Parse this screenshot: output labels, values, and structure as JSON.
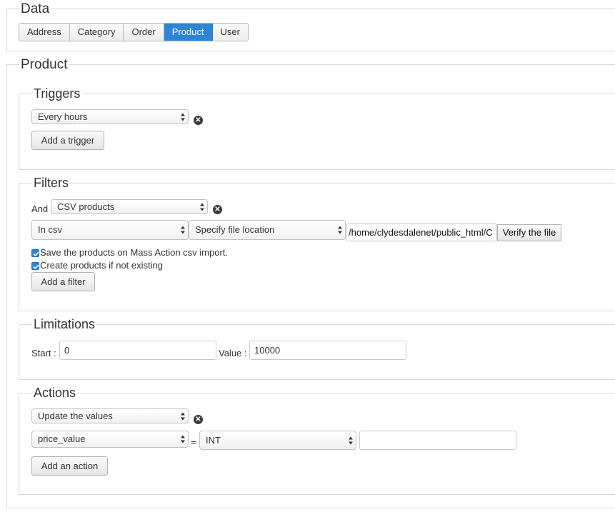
{
  "data_section": {
    "legend": "Data",
    "tabs": [
      {
        "label": "Address"
      },
      {
        "label": "Category"
      },
      {
        "label": "Order"
      },
      {
        "label": "Product"
      },
      {
        "label": "User"
      }
    ],
    "active_tab": "Product"
  },
  "product_section": {
    "legend": "Product",
    "triggers": {
      "legend": "Triggers",
      "select_value": "Every hours",
      "add_button": "Add a trigger"
    },
    "filters": {
      "legend": "Filters",
      "and_label": "And",
      "type_select_value": "CSV products",
      "in_csv_select_value": "In csv",
      "location_select_value": "Specify file location",
      "file_path_value": "/home/clydesdalenet/public_html/C",
      "verify_button": "Verify the file",
      "checkbox_save_label": "Save the products on Mass Action csv import.",
      "checkbox_create_label": "Create products if not existing",
      "add_button": "Add a filter"
    },
    "limitations": {
      "legend": "Limitations",
      "start_label": "Start :",
      "start_value": "0",
      "value_label": "Value :",
      "value_value": "10000"
    },
    "actions": {
      "legend": "Actions",
      "select_value": "Update the values",
      "field_select_value": "price_value",
      "equals_label": "=",
      "type_select_value": "INT",
      "value_input": "",
      "add_button": "Add an action"
    }
  },
  "colors": {
    "accent": "#2e84d6",
    "border": "#d8d8d8"
  }
}
